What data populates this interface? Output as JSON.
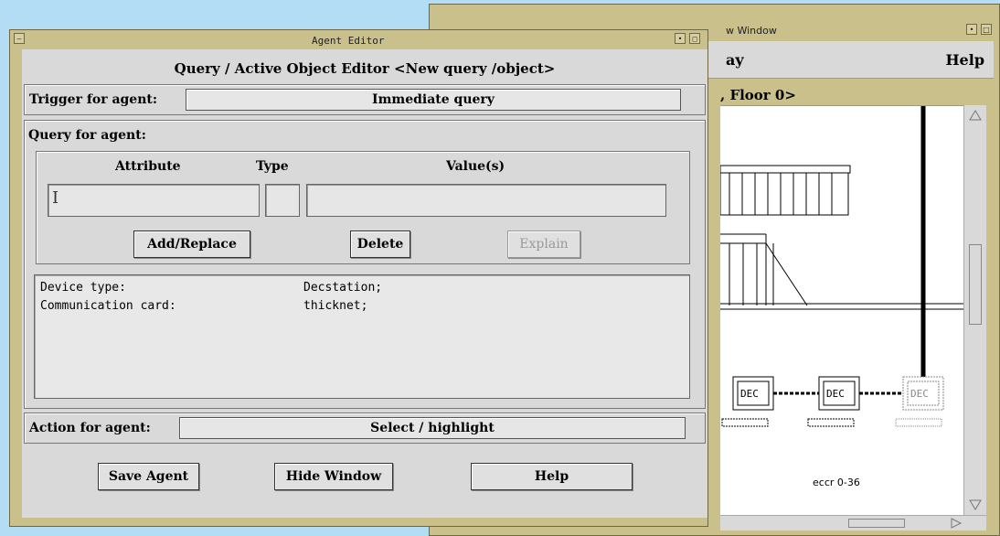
{
  "view_window": {
    "title": "w Window",
    "menu": {
      "display": "ay",
      "help": "Help"
    },
    "location": ", Floor 0>",
    "devices": [
      {
        "label": "DEC"
      },
      {
        "label": "DEC"
      },
      {
        "label": "DEC"
      }
    ],
    "caption": "eccr 0-36",
    "title_buttons": [
      "•",
      "□"
    ]
  },
  "editor": {
    "title": "Agent Editor",
    "heading": "Query / Active Object Editor <New query /object>",
    "trigger": {
      "label": "Trigger for agent:",
      "value": "Immediate query"
    },
    "query": {
      "label": "Query for agent:",
      "columns": {
        "attribute": "Attribute",
        "type": "Type",
        "values": "Value(s)"
      },
      "attribute_value": "",
      "type_value": "",
      "values_value": "",
      "buttons": {
        "add": "Add/Replace",
        "delete": "Delete",
        "explain": "Explain"
      },
      "rows": [
        {
          "attr": "Device type:",
          "val": "Decstation;"
        },
        {
          "attr": "Communication card:",
          "val": "thicknet;"
        }
      ]
    },
    "action": {
      "label": "Action for agent:",
      "value": "Select / highlight"
    },
    "footer": {
      "save": "Save Agent",
      "hide": "Hide Window",
      "help": "Help"
    },
    "title_buttons": [
      "—",
      "•",
      "□"
    ]
  }
}
